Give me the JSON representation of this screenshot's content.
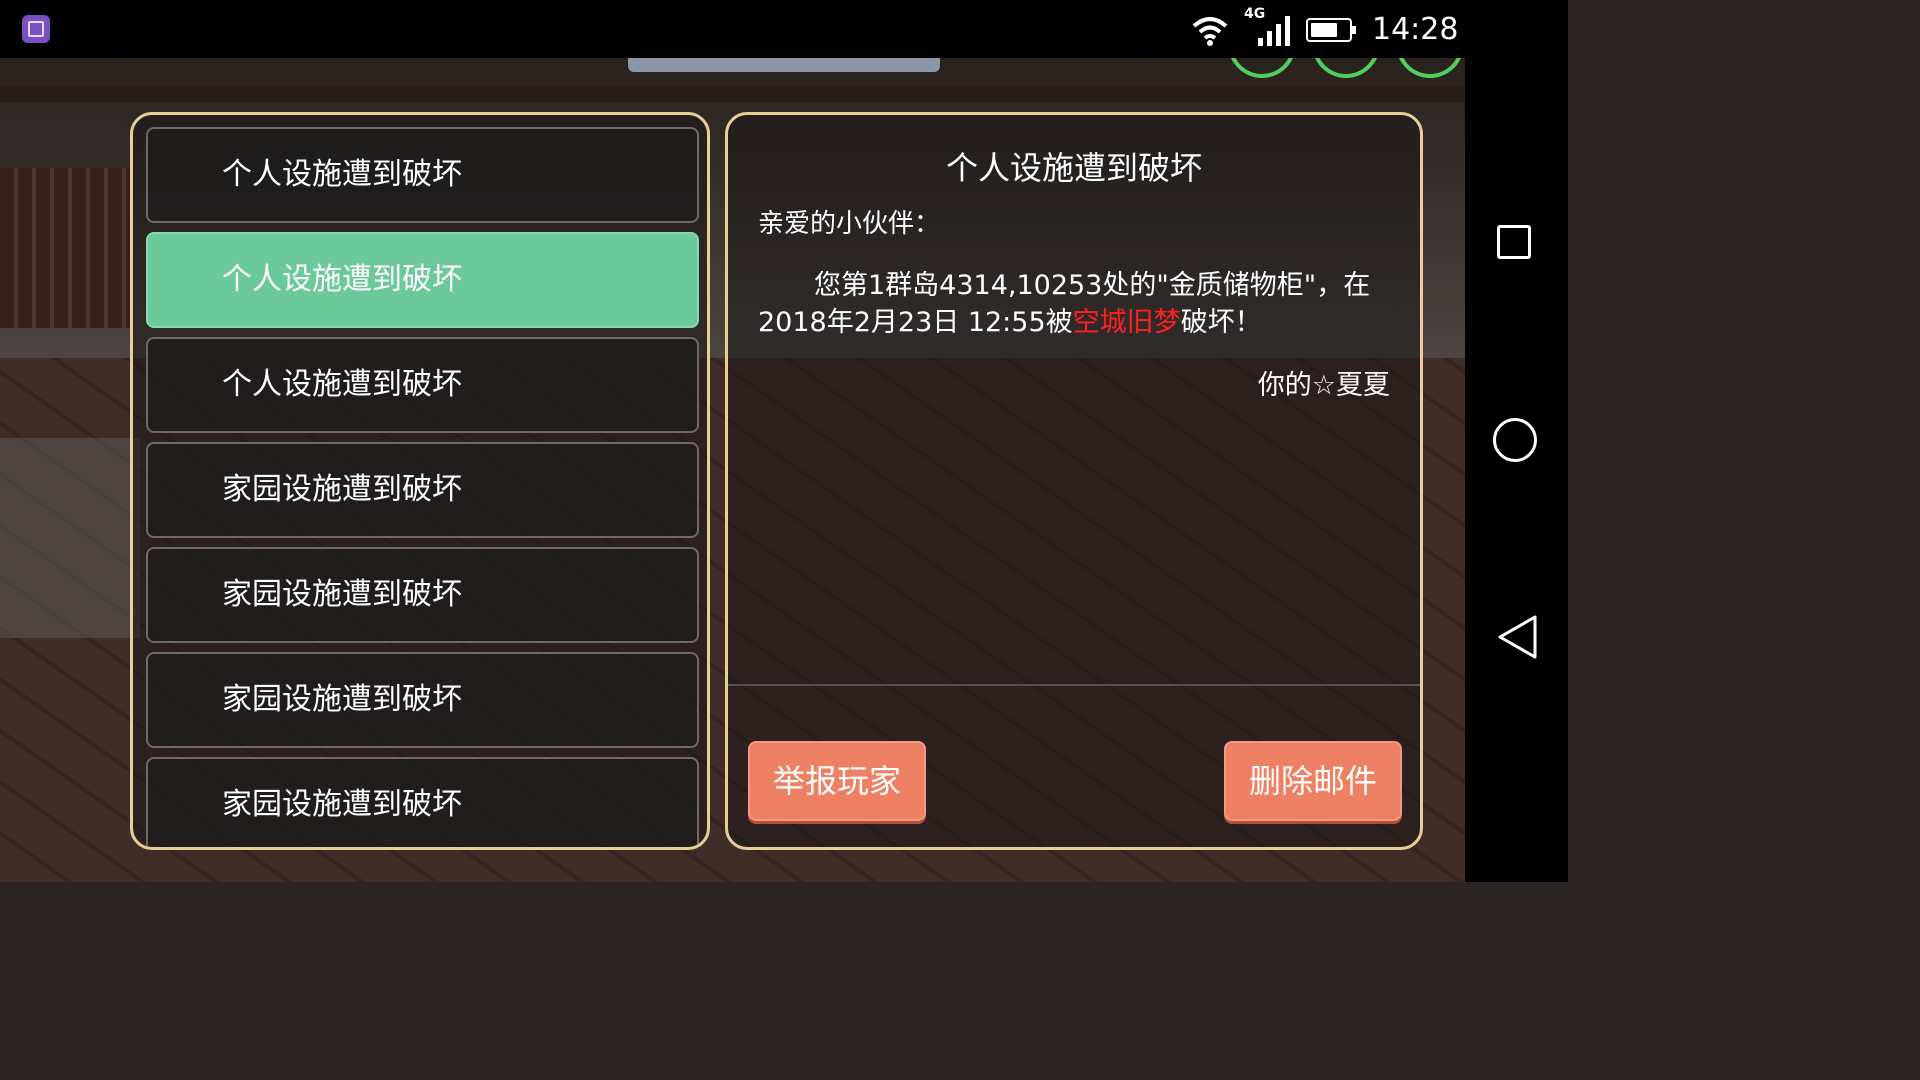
{
  "status_bar": {
    "network": "4G",
    "time": "14:28"
  },
  "mail_list": {
    "items": [
      {
        "label": "个人设施遭到破坏",
        "selected": false
      },
      {
        "label": "个人设施遭到破坏",
        "selected": true
      },
      {
        "label": "个人设施遭到破坏",
        "selected": false
      },
      {
        "label": "家园设施遭到破坏",
        "selected": false
      },
      {
        "label": "家园设施遭到破坏",
        "selected": false
      },
      {
        "label": "家园设施遭到破坏",
        "selected": false
      },
      {
        "label": "家园设施遭到破坏",
        "selected": false
      }
    ]
  },
  "mail_detail": {
    "title": "个人设施遭到破坏",
    "greeting": "亲爱的小伙伴：",
    "body_pre": "您第1群岛4314,10253处的\"金质储物柜\"，在2018年2月23日 12:55被",
    "body_player": "空城旧梦",
    "body_post": "破坏！",
    "signature": "你的☆夏夏"
  },
  "buttons": {
    "report": "举报玩家",
    "delete": "删除邮件"
  },
  "colors": {
    "selected_item": "#6cc99a",
    "panel_border": "#e8cf98",
    "button": "#ee8064",
    "player_name": "#ff2020"
  }
}
